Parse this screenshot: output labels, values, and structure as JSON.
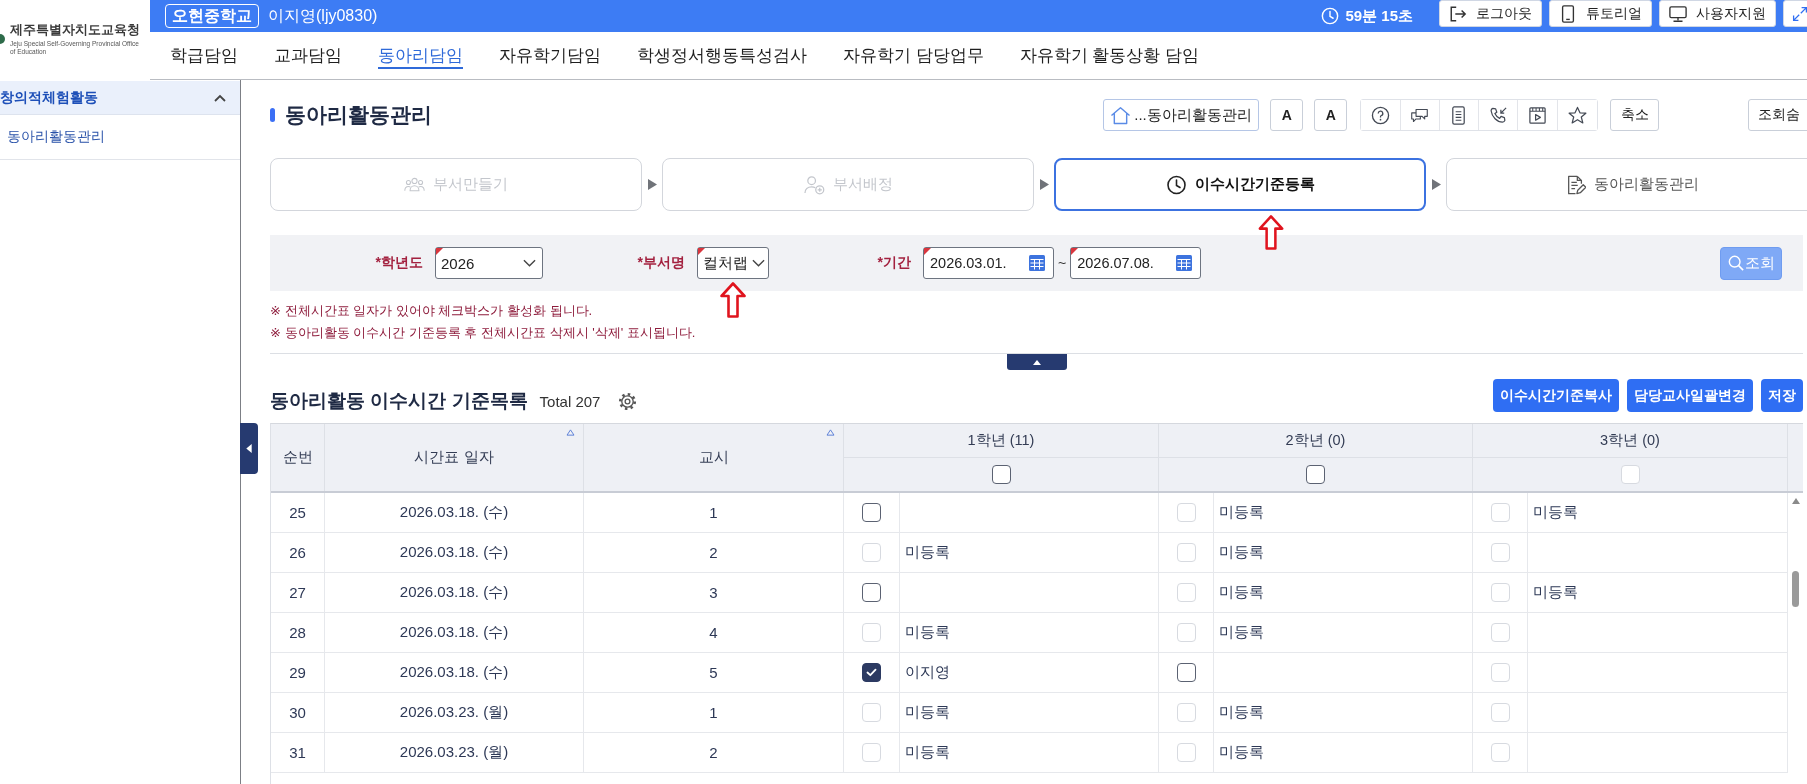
{
  "header": {
    "org_name": "제주특별자치도교육청",
    "org_subtitle": "Jeju Special Self-Governing Provincial Office of Education",
    "school": "오현중학교",
    "user": "이지영(ljy0830)",
    "timer": "59분 15초",
    "buttons": [
      "로그아웃",
      "튜토리얼",
      "사용자지원"
    ]
  },
  "nav": [
    {
      "label": "학급담임",
      "selected": false
    },
    {
      "label": "교과담임",
      "selected": false
    },
    {
      "label": "동아리담임",
      "selected": true
    },
    {
      "label": "자유학기담임",
      "selected": false
    },
    {
      "label": "학생정서행동특성검사",
      "selected": false
    },
    {
      "label": "자유학기 담당업무",
      "selected": false
    },
    {
      "label": "자유학기 활동상황 담임",
      "selected": false
    }
  ],
  "sidebar": {
    "section": "창의적체험활동",
    "expanded": true,
    "items": [
      "동아리활동관리"
    ]
  },
  "toolbar": {
    "page_title": "동아리활동관리",
    "home": "...동아리활동관리",
    "font_buttons": [
      "A",
      "A"
    ],
    "shrink": "축소",
    "partial_button": "조회숨"
  },
  "steps": [
    {
      "label": "부서만들기",
      "disabled": true,
      "selected": false,
      "marked": false
    },
    {
      "label": "부서배정",
      "disabled": true,
      "selected": false,
      "marked": false
    },
    {
      "label": "이수시간기준등록",
      "disabled": false,
      "selected": true,
      "marked": true
    },
    {
      "label": "동아리활동관리",
      "disabled": false,
      "selected": false,
      "marked": false
    }
  ],
  "filter": {
    "fields": [
      {
        "label": "*학년도",
        "kind": "select",
        "value": "2026",
        "marked": false
      },
      {
        "label": "*부서명",
        "kind": "select",
        "value": "컬처랩",
        "marked": true
      },
      {
        "label": "*기간",
        "kind": "date_range",
        "from": "2026.03.01.",
        "separator": "~",
        "to": "2026.07.08.",
        "marked": false
      }
    ],
    "search_button": "조회"
  },
  "notes": [
    "※ 전체시간표 일자가 있어야 체크박스가 활성화 됩니다.",
    "※ 동아리활동 이수시간 기준등록 후 전체시간표 삭제시 '삭제' 표시됩니다."
  ],
  "grid": {
    "title": "동아리활동 이수시간 기준목록",
    "total": "Total 207",
    "buttons": [
      "이수시간기준복사",
      "담당교사일괄변경",
      "저장"
    ],
    "columns": [
      {
        "label": "순번",
        "sortable": false
      },
      {
        "label": "시간표 일자",
        "sortable": true
      },
      {
        "label": "교시",
        "sortable": true
      }
    ],
    "grades": [
      {
        "label": "1학년 (11)",
        "checked": false,
        "disabled": false
      },
      {
        "label": "2학년 (0)",
        "checked": false,
        "disabled": false
      },
      {
        "label": "3학년 (0)",
        "checked": false,
        "disabled": true
      }
    ],
    "rows": [
      {
        "no": "25",
        "date": "2026.03.18. (수)",
        "period": "1",
        "cells": [
          {
            "checked": false,
            "disabled": false
          },
          {
            "checked": false,
            "disabled": true,
            "name": "미등록"
          },
          {
            "checked": false,
            "disabled": true,
            "name": "미등록"
          }
        ]
      },
      {
        "no": "26",
        "date": "2026.03.18. (수)",
        "period": "2",
        "cells": [
          {
            "checked": false,
            "disabled": true,
            "name": "미등록"
          },
          {
            "checked": false,
            "disabled": true,
            "name": "미등록"
          },
          {
            "checked": false,
            "disabled": true
          }
        ]
      },
      {
        "no": "27",
        "date": "2026.03.18. (수)",
        "period": "3",
        "cells": [
          {
            "checked": false,
            "disabled": false
          },
          {
            "checked": false,
            "disabled": true,
            "name": "미등록"
          },
          {
            "checked": false,
            "disabled": true,
            "name": "미등록"
          }
        ]
      },
      {
        "no": "28",
        "date": "2026.03.18. (수)",
        "period": "4",
        "cells": [
          {
            "checked": false,
            "disabled": true,
            "name": "미등록"
          },
          {
            "checked": false,
            "disabled": true,
            "name": "미등록"
          },
          {
            "checked": false,
            "disabled": true
          }
        ]
      },
      {
        "no": "29",
        "date": "2026.03.18. (수)",
        "period": "5",
        "cells": [
          {
            "checked": true,
            "disabled": false,
            "name": "이지영"
          },
          {
            "checked": false,
            "disabled": false
          },
          {
            "checked": false,
            "disabled": true
          }
        ]
      },
      {
        "no": "30",
        "date": "2026.03.23. (월)",
        "period": "1",
        "cells": [
          {
            "checked": false,
            "disabled": true,
            "name": "미등록"
          },
          {
            "checked": false,
            "disabled": true,
            "name": "미등록"
          },
          {
            "checked": false,
            "disabled": true
          }
        ]
      },
      {
        "no": "31",
        "date": "2026.03.23. (월)",
        "period": "2",
        "cells": [
          {
            "checked": false,
            "disabled": true,
            "name": "미등록"
          },
          {
            "checked": false,
            "disabled": true,
            "name": "미등록"
          },
          {
            "checked": false,
            "disabled": true
          }
        ]
      }
    ]
  }
}
